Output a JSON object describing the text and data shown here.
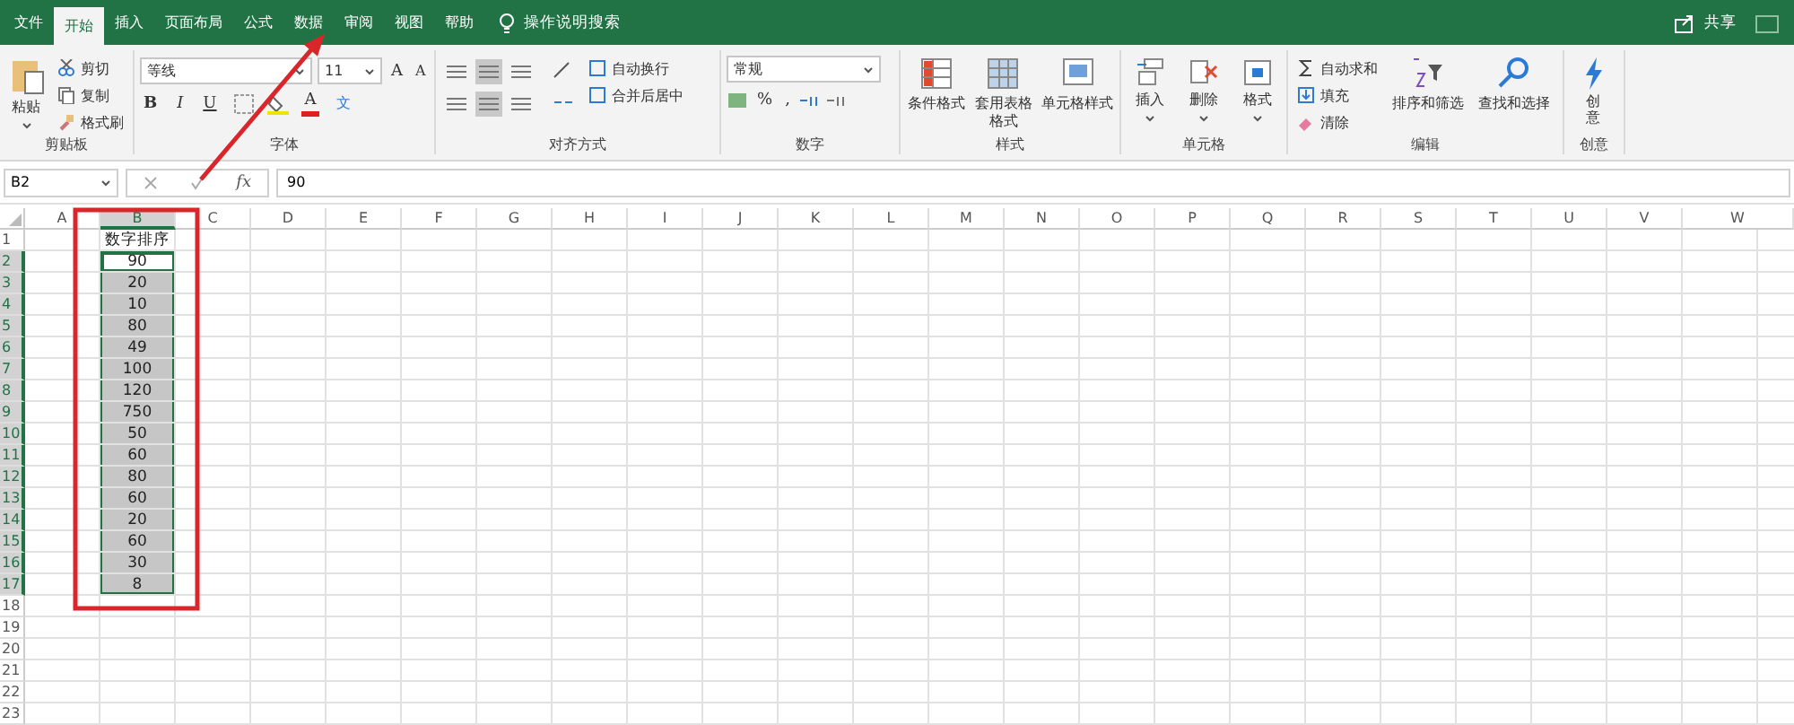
{
  "tabs": [
    {
      "label": "文件",
      "selected": false
    },
    {
      "label": "开始",
      "selected": true
    },
    {
      "label": "插入",
      "selected": false
    },
    {
      "label": "页面布局",
      "selected": false
    },
    {
      "label": "公式",
      "selected": false
    },
    {
      "label": "数据",
      "selected": false
    },
    {
      "label": "审阅",
      "selected": false
    },
    {
      "label": "视图",
      "selected": false
    },
    {
      "label": "帮助",
      "selected": false
    }
  ],
  "tell_me": "操作说明搜索",
  "share": "共享",
  "clipboard": {
    "label": "剪贴板",
    "paste": "粘贴",
    "small": [
      "剪切",
      "复制",
      "格式刷"
    ]
  },
  "font": {
    "label": "字体",
    "font_name": "等线",
    "font_size": "11",
    "grow": "A",
    "shrink": "A",
    "format_buttons": [
      "B",
      "I",
      "U"
    ],
    "font_color": "A",
    "phonetic": "文"
  },
  "alignment": {
    "label": "对齐方式",
    "small": [
      "自动换行",
      "合并后居中"
    ]
  },
  "number": {
    "label": "数字",
    "format": "常规",
    "symbols": [
      "%",
      ","
    ]
  },
  "styles": {
    "label": "样式",
    "large": [
      "条件格式",
      "套用表格格式",
      "单元格样式"
    ]
  },
  "cells": {
    "label": "单元格",
    "large": [
      "插入",
      "删除",
      "格式"
    ]
  },
  "editing": {
    "label": "编辑",
    "small": [
      "自动求和",
      "填充",
      "清除"
    ],
    "large": [
      "排序和筛选",
      "查找和选择"
    ]
  },
  "ideas": {
    "label": "创意",
    "button": "创意"
  },
  "name_box": "B2",
  "fx": "fx",
  "formula": "90",
  "columns": [
    "A",
    "B",
    "C",
    "D",
    "E",
    "F",
    "G",
    "H",
    "I",
    "J",
    "K",
    "L",
    "M",
    "N",
    "O",
    "P",
    "Q",
    "R",
    "S",
    "T",
    "U",
    "V",
    "W"
  ],
  "rows": [
    {
      "header": "1",
      "b": {
        "text": "数字排序",
        "selected": false,
        "active": false
      }
    },
    {
      "header": "2",
      "b": {
        "text": "90",
        "selected": true,
        "active": true
      }
    },
    {
      "header": "3",
      "b": {
        "text": "20",
        "selected": true,
        "active": false
      }
    },
    {
      "header": "4",
      "b": {
        "text": "10",
        "selected": true,
        "active": false
      }
    },
    {
      "header": "5",
      "b": {
        "text": "80",
        "selected": true,
        "active": false
      }
    },
    {
      "header": "6",
      "b": {
        "text": "49",
        "selected": true,
        "active": false
      }
    },
    {
      "header": "7",
      "b": {
        "text": "100",
        "selected": true,
        "active": false
      }
    },
    {
      "header": "8",
      "b": {
        "text": "120",
        "selected": true,
        "active": false
      }
    },
    {
      "header": "9",
      "b": {
        "text": "750",
        "selected": true,
        "active": false
      }
    },
    {
      "header": "10",
      "b": {
        "text": "50",
        "selected": true,
        "active": false
      }
    },
    {
      "header": "11",
      "b": {
        "text": "60",
        "selected": true,
        "active": false
      }
    },
    {
      "header": "12",
      "b": {
        "text": "80",
        "selected": true,
        "active": false
      }
    },
    {
      "header": "13",
      "b": {
        "text": "60",
        "selected": true,
        "active": false
      }
    },
    {
      "header": "14",
      "b": {
        "text": "20",
        "selected": true,
        "active": false
      }
    },
    {
      "header": "15",
      "b": {
        "text": "60",
        "selected": true,
        "active": false
      }
    },
    {
      "header": "16",
      "b": {
        "text": "30",
        "selected": true,
        "active": false
      }
    },
    {
      "header": "17",
      "b": {
        "text": "8",
        "selected": true,
        "active": false
      }
    },
    {
      "header": "18"
    },
    {
      "header": "19"
    },
    {
      "header": "20"
    },
    {
      "header": "21"
    },
    {
      "header": "22"
    },
    {
      "header": "23"
    }
  ]
}
